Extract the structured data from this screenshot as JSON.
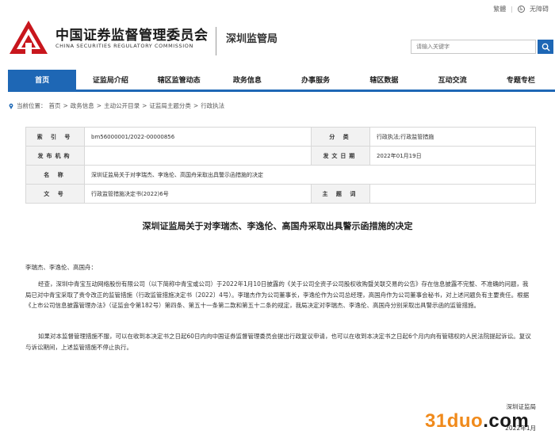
{
  "util_bar": {
    "traditional": "繁體",
    "accessibility": "无障碍"
  },
  "header": {
    "brand_cn": "中国证券监督管理委员会",
    "brand_en": "CHINA SECURITIES REGULATORY COMMISSION",
    "bureau": "深圳监管局",
    "search_placeholder": "请输入关键字"
  },
  "nav": {
    "items": [
      "首页",
      "证监局介绍",
      "辖区监管动态",
      "政务信息",
      "办事服务",
      "辖区数据",
      "互动交流",
      "专题专栏"
    ]
  },
  "breadcrumb": {
    "prefix": "当前位置：",
    "items": [
      "首页",
      "政务信息",
      "主动公开目录",
      "证监局主题分类",
      "行政执法"
    ],
    "sep": " > "
  },
  "meta": {
    "index_label": "索 引 号",
    "index_value": "bm56000001/2022-00000856",
    "category_label": "分 类",
    "category_value": "行政执法;行政监管措施",
    "issuer_label": "发布机构",
    "issuer_value": "",
    "date_label": "发文日期",
    "date_value": "2022年01月19日",
    "name_label": "名 称",
    "name_value": "深圳证监局关于对李瑞杰、李逸伦、高国舟采取出具警示函措施的决定",
    "doc_label": "文 号",
    "doc_value": "行政监管措施决定书(2022)6号",
    "subject_label": "主 题 词",
    "subject_value": ""
  },
  "article": {
    "title": "深圳证监局关于对李瑞杰、李逸伦、高国舟采取出具警示函措施的决定",
    "salutation": "李瑞杰、李逸伦、高国舟：",
    "para1": "经查，深圳中青宝互动网络股份有限公司（以下简称中青宝或公司）于2022年1月10日披露的《关于公司全资子公司股权收购暨关联交易的公告》存在信息披露不完整、不准确的问题，我局已对中青宝采取了责令改正的监管措施（行政监管措施决定书〔2022〕4号）。李瑞杰作为公司董事长，李逸伦作为公司总经理，高国舟作为公司董事会秘书，对上述问题负有主要责任。根据《上市公司信息披露管理办法》（证监会令第182号）第四条、第五十一条第二款和第五十二条的规定，我局决定对李瑞杰、李逸伦、高国舟分别采取出具警示函的监管措施。",
    "para2": "如果对本监督管理措施不服，可以在收到本决定书之日起60日内向中国证券监督管理委员会提出行政复议申请，也可以在收到本决定书之日起6个月内向有管辖权的人民法院提起诉讼。复议与诉讼期间，上述监管措施不停止执行。",
    "signature": "深圳证监局",
    "sign_date": "2022年1月"
  },
  "watermark": {
    "prefix": "31duo",
    "suffix": ".com"
  },
  "colors": {
    "brand_blue": "#1e67b5",
    "logo_red": "#c8161d",
    "watermark_orange": "#f08a1b"
  }
}
